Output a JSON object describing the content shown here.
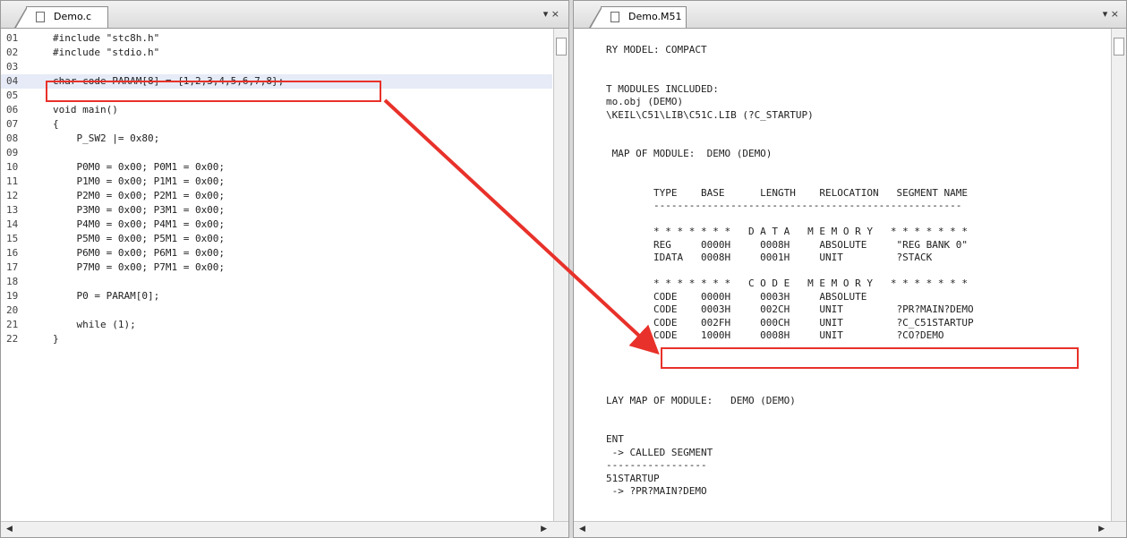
{
  "left_tab": {
    "title": "Demo.c",
    "controls": "▾ ×"
  },
  "right_tab": {
    "title": "Demo.M51",
    "controls": "▾ ×"
  },
  "code_lines": [
    {
      "num": "01",
      "text": "#include \"stc8h.h\""
    },
    {
      "num": "02",
      "text": "#include \"stdio.h\""
    },
    {
      "num": "03",
      "text": ""
    },
    {
      "num": "04",
      "text": "char code PARAM[8] = {1,2,3,4,5,6,7,8};"
    },
    {
      "num": "05",
      "text": ""
    },
    {
      "num": "06",
      "text": "void main()"
    },
    {
      "num": "07",
      "text": "{"
    },
    {
      "num": "08",
      "text": "    P_SW2 |= 0x80;"
    },
    {
      "num": "09",
      "text": ""
    },
    {
      "num": "10",
      "text": "    P0M0 = 0x00; P0M1 = 0x00;"
    },
    {
      "num": "11",
      "text": "    P1M0 = 0x00; P1M1 = 0x00;"
    },
    {
      "num": "12",
      "text": "    P2M0 = 0x00; P2M1 = 0x00;"
    },
    {
      "num": "13",
      "text": "    P3M0 = 0x00; P3M1 = 0x00;"
    },
    {
      "num": "14",
      "text": "    P4M0 = 0x00; P4M1 = 0x00;"
    },
    {
      "num": "15",
      "text": "    P5M0 = 0x00; P5M1 = 0x00;"
    },
    {
      "num": "16",
      "text": "    P6M0 = 0x00; P6M1 = 0x00;"
    },
    {
      "num": "17",
      "text": "    P7M0 = 0x00; P7M1 = 0x00;"
    },
    {
      "num": "18",
      "text": ""
    },
    {
      "num": "19",
      "text": "    P0 = PARAM[0];"
    },
    {
      "num": "20",
      "text": ""
    },
    {
      "num": "21",
      "text": "    while (1);"
    },
    {
      "num": "22",
      "text": "}"
    }
  ],
  "map_lines": [
    {
      "text": "RY MODEL: COMPACT"
    },
    {
      "text": ""
    },
    {
      "text": ""
    },
    {
      "text": "T MODULES INCLUDED:"
    },
    {
      "text": "mo.obj (DEMO)"
    },
    {
      "text": "\\KEIL\\C51\\LIB\\C51C.LIB (?C_STARTUP)"
    },
    {
      "text": ""
    },
    {
      "text": ""
    },
    {
      "text": " MAP OF MODULE:  DEMO (DEMO)"
    },
    {
      "text": ""
    },
    {
      "text": ""
    },
    {
      "text": "        TYPE    BASE      LENGTH    RELOCATION   SEGMENT NAME"
    },
    {
      "text": "        ----------------------------------------------------"
    },
    {
      "text": ""
    },
    {
      "text": "        * * * * * * *   D A T A   M E M O R Y   * * * * * * *"
    },
    {
      "text": "        REG     0000H     0008H     ABSOLUTE     \"REG BANK 0\""
    },
    {
      "text": "        IDATA   0008H     0001H     UNIT         ?STACK"
    },
    {
      "text": ""
    },
    {
      "text": "        * * * * * * *   C O D E   M E M O R Y   * * * * * * *"
    },
    {
      "text": "        CODE    0000H     0003H     ABSOLUTE"
    },
    {
      "text": "        CODE    0003H     002CH     UNIT         ?PR?MAIN?DEMO"
    },
    {
      "text": "        CODE    002FH     000CH     UNIT         ?C_C51STARTUP"
    },
    {
      "text": "        CODE    1000H     0008H     UNIT         ?CO?DEMO"
    },
    {
      "text": ""
    },
    {
      "text": ""
    },
    {
      "text": ""
    },
    {
      "text": ""
    },
    {
      "text": "LAY MAP OF MODULE:   DEMO (DEMO)"
    },
    {
      "text": ""
    },
    {
      "text": ""
    },
    {
      "text": "ENT"
    },
    {
      "text": " -> CALLED SEGMENT"
    },
    {
      "text": "-----------------"
    },
    {
      "text": "51STARTUP"
    },
    {
      "text": " -> ?PR?MAIN?DEMO"
    }
  ],
  "colors": {
    "highlight_box": "#e8312a",
    "arrow": "#e8312a",
    "line_highlight": "#e6ebf7"
  }
}
